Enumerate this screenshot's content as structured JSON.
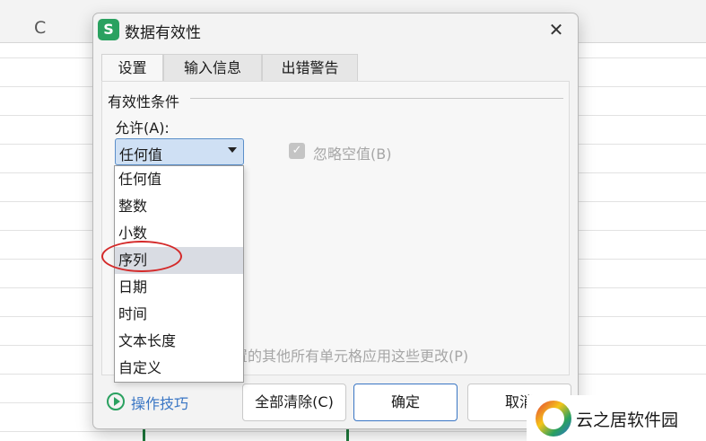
{
  "sheet": {
    "column_letter": "C"
  },
  "dialog": {
    "app_icon": "S",
    "title": "数据有效性",
    "close_icon": "✕",
    "tabs": [
      {
        "label": "设置",
        "active": true
      },
      {
        "label": "输入信息",
        "active": false
      },
      {
        "label": "出错警告",
        "active": false
      }
    ],
    "group_label": "有效性条件",
    "allow_label": "允许(A):",
    "allow_select": {
      "value": "任何值"
    },
    "ignore_blank": {
      "label": "忽略空值(B)",
      "checked": true,
      "disabled": true
    },
    "apply_all_text": "置的其他所有单元格应用这些更改(P)",
    "tips_label": "操作技巧",
    "buttons": {
      "clear_all": "全部清除(C)",
      "ok": "确定",
      "cancel": "取消"
    }
  },
  "dropdown": {
    "options": [
      "任何值",
      "整数",
      "小数",
      "序列",
      "日期",
      "时间",
      "文本长度",
      "自定义"
    ],
    "highlighted": "序列"
  },
  "watermark": {
    "text": "云之居软件园"
  },
  "colors": {
    "accent": "#3a76c4",
    "brand_green": "#2aa160",
    "annotation_red": "#d42a2a"
  }
}
